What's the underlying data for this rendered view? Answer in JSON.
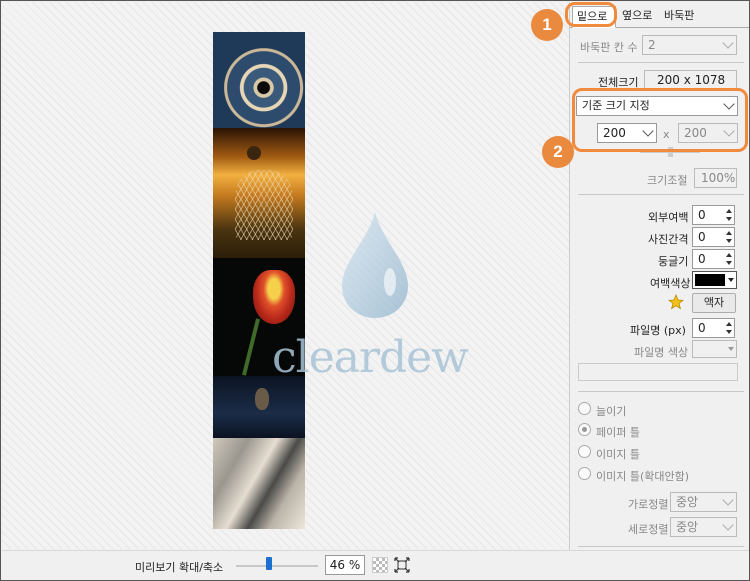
{
  "preview": {
    "watermark_text": "cleardew",
    "zoom_label": "미리보기 확대/축소",
    "zoom_value": "46 %",
    "zoom_slider_fraction": 0.4
  },
  "tabs": [
    {
      "label": "밑으로",
      "active": true
    },
    {
      "label": "옆으로",
      "active": false
    },
    {
      "label": "바둑판",
      "active": false
    }
  ],
  "panel": {
    "grid_count_label": "바둑판 칸 수",
    "grid_count_value": "2",
    "total_size_label": "전체크기",
    "total_size_value": "200 x 1078",
    "size_mode_value": "기준 크기 지정",
    "width_value": "200",
    "x_sep": "x",
    "height_value": "200",
    "scale_label": "크기조절",
    "scale_value": "100%",
    "outer_margin_label": "외부여백",
    "outer_margin_value": "0",
    "spacing_label": "사진간격",
    "spacing_value": "0",
    "roundness_label": "둥글기",
    "roundness_value": "0",
    "margin_color_label": "여백색상",
    "margin_color": "#000000",
    "frame_button": "액자",
    "filename_label": "파일명 (px)",
    "filename_value": "0",
    "filename_color_label": "파일명 색상",
    "radios": [
      {
        "label": "늘이기",
        "checked": false
      },
      {
        "label": "페이퍼 틀",
        "checked": true
      },
      {
        "label": "이미지 틀",
        "checked": false
      },
      {
        "label": "이미지 틀(확대안함)",
        "checked": false
      }
    ],
    "h_align_label": "가로정렬",
    "h_align_value": "중앙",
    "v_align_label": "세로정렬",
    "v_align_value": "중앙"
  },
  "callouts": [
    "1",
    "2"
  ],
  "colors": {
    "accent": "#e98a3f",
    "slider": "#1c6fd0",
    "watermark": "#a9c3d6"
  }
}
